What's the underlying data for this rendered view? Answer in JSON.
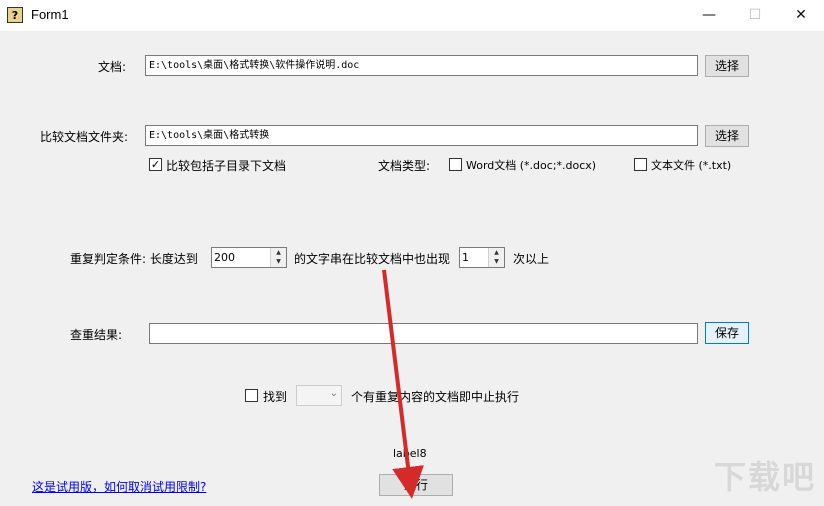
{
  "window": {
    "title": "Form1",
    "minimize": "—",
    "maximize": "☐",
    "close": "✕",
    "icon_glyph": "?"
  },
  "document": {
    "label": "文档:",
    "value": "E:\\tools\\桌面\\格式转换\\软件操作说明.doc",
    "button": "选择"
  },
  "compare_folder": {
    "label": "比较文档文件夹:",
    "value": "E:\\tools\\桌面\\格式转换",
    "button": "选择"
  },
  "options": {
    "include_subdirs": {
      "label": "比较包括子目录下文档",
      "checked": true
    },
    "doc_type_label": "文档类型:",
    "word": {
      "label": "Word文档 (*.doc;*.docx)",
      "checked": false
    },
    "text": {
      "label": "文本文件 (*.txt)",
      "checked": false
    }
  },
  "condition": {
    "label": "重复判定条件: 长度达到",
    "length_value": "200",
    "middle_text": "的文字串在比较文档中也出现",
    "count_value": "1",
    "suffix": "次以上"
  },
  "result": {
    "label": "查重结果:",
    "value": "",
    "button": "保存"
  },
  "stop": {
    "label_before": "找到",
    "label_after": "个有重复内容的文档即中止执行",
    "checked": false,
    "selected": ""
  },
  "status_label": "label8",
  "run_button": "运行",
  "help_link": "这是试用版，如何取消试用限制?",
  "watermark": "下载吧"
}
